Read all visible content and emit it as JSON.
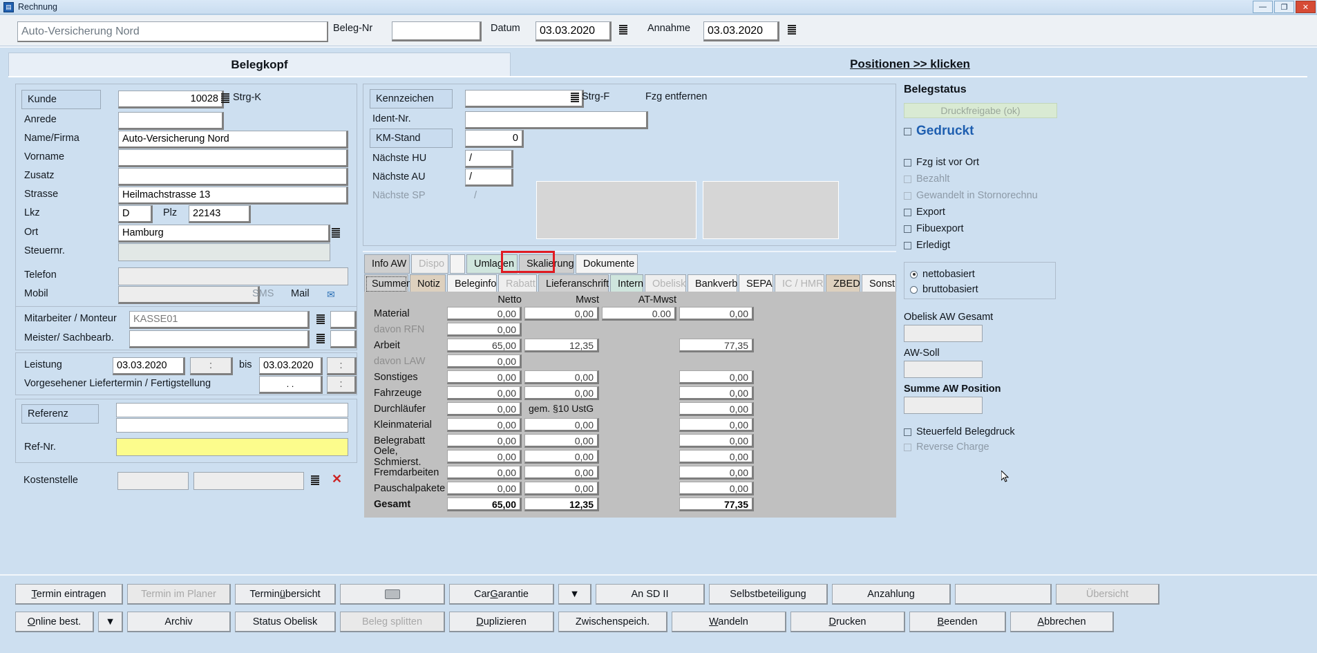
{
  "window": {
    "title": "Rechnung",
    "minimize": "—",
    "maximize": "❐",
    "close": "✕"
  },
  "toprow": {
    "customer_name": "Auto-Versicherung Nord",
    "beleg_nr_label": "Beleg-Nr",
    "beleg_nr_value": "",
    "datum_label": "Datum",
    "datum_value": "03.03.2020",
    "annahme_label": "Annahme",
    "annahme_value": "03.03.2020"
  },
  "panels": {
    "belegkopf_title": "Belegkopf",
    "positionen_title": "Positionen >> klicken"
  },
  "customer": {
    "kunde_label": "Kunde",
    "kunde_value": "10028",
    "kunde_shortcut": "Strg-K",
    "anrede_label": "Anrede",
    "anrede_value": "",
    "name_label": "Name/Firma",
    "name_value": "Auto-Versicherung Nord",
    "vorname_label": "Vorname",
    "vorname_value": "",
    "zusatz_label": "Zusatz",
    "zusatz_value": "",
    "strasse_label": "Strasse",
    "strasse_value": "Heilmachstrasse 13",
    "lkz_label": "Lkz",
    "lkz_value": "D",
    "plz_label": "Plz",
    "plz_value": "22143",
    "ort_label": "Ort",
    "ort_value": "Hamburg",
    "steuernr_label": "Steuernr.",
    "steuernr_value": "",
    "telefon_label": "Telefon",
    "telefon_value": "",
    "mobil_label": "Mobil",
    "mobil_value": "",
    "sms_label": "SMS",
    "mail_label": "Mail"
  },
  "staff": {
    "mitarbeiter_label": "Mitarbeiter / Monteur",
    "mitarbeiter_value": "KASSE01",
    "meister_label": "Meister/ Sachbearb.",
    "meister_value": ""
  },
  "service": {
    "leistung_label": "Leistung",
    "leistung_from": "03.03.2020",
    "leistung_from_time": ":",
    "bis_label": "bis",
    "leistung_to": "03.03.2020",
    "leistung_to_time": ":",
    "liefertermin_label": "Vorgesehener Liefertermin / Fertigstellung",
    "liefertermin_date": ".  .",
    "liefertermin_time": ":"
  },
  "reference": {
    "referenz_label": "Referenz",
    "referenz_line1": "",
    "referenz_line2": "",
    "refnr_label": "Ref-Nr.",
    "refnr_value": "",
    "kostenstelle_label": "Kostenstelle",
    "kostenstelle_value1": "",
    "kostenstelle_value2": "",
    "clear_icon": "✕"
  },
  "vehicle": {
    "kennzeichen_label": "Kennzeichen",
    "kennzeichen_value": "",
    "kennzeichen_shortcut": "Strg-F",
    "fzg_entfernen_label": "Fzg entfernen",
    "ident_label": "Ident-Nr.",
    "ident_value": "",
    "km_label": "KM-Stand",
    "km_value": "0",
    "hu_label": "Nächste HU",
    "hu_value": "/",
    "au_label": "Nächste AU",
    "au_value": "/",
    "sp_label": "Nächste SP",
    "sp_value": "/"
  },
  "tabs_row1": [
    {
      "label": "Info AW",
      "style": "grey",
      "state": "normal"
    },
    {
      "label": "Dispo",
      "style": "grey",
      "state": "disabled"
    },
    {
      "label": "",
      "style": "light",
      "state": "normal"
    },
    {
      "label": "Umlagen",
      "style": "mint",
      "state": "normal"
    },
    {
      "label": "Skalierung",
      "style": "grey",
      "state": "highlighted"
    },
    {
      "label": "Dokumente",
      "style": "light",
      "state": "normal"
    }
  ],
  "tabs_row2": [
    {
      "label": "Summen",
      "style": "grey",
      "state": "selected"
    },
    {
      "label": "Notiz",
      "style": "tan",
      "state": "normal"
    },
    {
      "label": "Beleginfo",
      "style": "light",
      "state": "normal"
    },
    {
      "label": "Rabatt",
      "style": "grey",
      "state": "disabled"
    },
    {
      "label": "Lieferanschrift",
      "style": "grey",
      "state": "normal"
    },
    {
      "label": "Intern",
      "style": "mint",
      "state": "normal"
    },
    {
      "label": "Obelisk",
      "style": "light",
      "state": "disabled"
    },
    {
      "label": "Bankverb",
      "style": "light",
      "state": "normal"
    },
    {
      "label": "SEPA",
      "style": "light",
      "state": "normal"
    },
    {
      "label": "IC / HMR",
      "style": "light",
      "state": "disabled"
    },
    {
      "label": "ZBED",
      "style": "tan",
      "state": "normal"
    },
    {
      "label": "Sonst",
      "style": "light",
      "state": "normal"
    }
  ],
  "summen": {
    "columns": [
      "Netto",
      "Mwst",
      "AT-Mwst",
      ""
    ],
    "rows": [
      {
        "label": "Material",
        "dim": false,
        "bold": false,
        "netto": "0,00",
        "mwst": "0,00",
        "atmwst": "0.00",
        "total": "0,00"
      },
      {
        "label": "davon RFN",
        "dim": true,
        "bold": false,
        "netto": "0,00",
        "mwst": "",
        "atmwst": "",
        "total": ""
      },
      {
        "label": "Arbeit",
        "dim": false,
        "bold": false,
        "netto": "65,00",
        "mwst": "12,35",
        "atmwst": "",
        "total": "77,35"
      },
      {
        "label": "davon LAW",
        "dim": true,
        "bold": false,
        "netto": "0,00",
        "mwst": "",
        "atmwst": "",
        "total": ""
      },
      {
        "label": "Sonstiges",
        "dim": false,
        "bold": false,
        "netto": "0,00",
        "mwst": "0,00",
        "atmwst": "",
        "total": "0,00"
      },
      {
        "label": "Fahrzeuge",
        "dim": false,
        "bold": false,
        "netto": "0,00",
        "mwst": "0,00",
        "atmwst": "",
        "total": "0,00"
      },
      {
        "label": "Durchläufer",
        "dim": false,
        "bold": false,
        "netto": "0,00",
        "mwst": "gem. §10 UstG",
        "atmwst": "",
        "total": "0,00"
      },
      {
        "label": "Kleinmaterial",
        "dim": false,
        "bold": false,
        "netto": "0,00",
        "mwst": "0,00",
        "atmwst": "",
        "total": "0,00"
      },
      {
        "label": "Belegrabatt",
        "dim": false,
        "bold": false,
        "netto": "0,00",
        "mwst": "0,00",
        "atmwst": "",
        "total": "0,00"
      },
      {
        "label": "Oele, Schmierst.",
        "dim": false,
        "bold": false,
        "netto": "0,00",
        "mwst": "0,00",
        "atmwst": "",
        "total": "0,00"
      },
      {
        "label": "Fremdarbeiten",
        "dim": false,
        "bold": false,
        "netto": "0,00",
        "mwst": "0,00",
        "atmwst": "",
        "total": "0,00"
      },
      {
        "label": "Pauschalpakete",
        "dim": false,
        "bold": false,
        "netto": "0,00",
        "mwst": "0,00",
        "atmwst": "",
        "total": "0,00"
      },
      {
        "label": "Gesamt",
        "dim": false,
        "bold": true,
        "netto": "65,00",
        "mwst": "12,35",
        "atmwst": "",
        "total": "77,35"
      }
    ]
  },
  "status": {
    "title": "Belegstatus",
    "druckfreigabe": "Druckfreigabe (ok)",
    "gedruckt": "Gedruckt",
    "checkboxes": [
      {
        "label": "Fzg ist vor Ort",
        "dim": false
      },
      {
        "label": "Bezahlt",
        "dim": true
      },
      {
        "label": "Gewandelt in Stornorechnu",
        "dim": true
      },
      {
        "label": "Export",
        "dim": false
      },
      {
        "label": "Fibuexport",
        "dim": false
      },
      {
        "label": "Erledigt",
        "dim": false
      }
    ],
    "radios": [
      {
        "label": "nettobasiert",
        "selected": true
      },
      {
        "label": "bruttobasiert",
        "selected": false
      }
    ],
    "obelisk_aw_label": "Obelisk AW Gesamt",
    "obelisk_aw_value": "",
    "aw_soll_label": "AW-Soll",
    "aw_soll_value": "",
    "summe_aw_label": "Summe AW Position",
    "summe_aw_value": "",
    "steuerfeld_label": "Steuerfeld Belegdruck",
    "reverse_charge_label": "Reverse Charge"
  },
  "buttons_row1": [
    {
      "label": "Termin eintragen",
      "accesskey": "T",
      "disabled": false
    },
    {
      "label": "Termin im Planer",
      "accesskey": "",
      "disabled": true
    },
    {
      "label": "Terminübersicht",
      "accesskey": "ü",
      "disabled": false
    },
    {
      "label": "",
      "accesskey": "",
      "disabled": false,
      "icon": "printer-icon"
    },
    {
      "label": "CarGarantie",
      "accesskey": "G",
      "disabled": false
    },
    {
      "label": "▼",
      "accesskey": "",
      "disabled": false
    },
    {
      "label": "An SD II",
      "accesskey": "",
      "disabled": false
    },
    {
      "label": "Selbstbeteiligung",
      "accesskey": "",
      "disabled": false
    },
    {
      "label": "Anzahlung",
      "accesskey": "",
      "disabled": false
    },
    {
      "label": "",
      "accesskey": "",
      "disabled": false
    },
    {
      "label": "Übersicht",
      "accesskey": "",
      "disabled": true
    }
  ],
  "buttons_row2": [
    {
      "label": "Online best.",
      "accesskey": "O",
      "disabled": false
    },
    {
      "label": "▼",
      "accesskey": "",
      "disabled": false
    },
    {
      "label": "Archiv",
      "accesskey": "",
      "disabled": false
    },
    {
      "label": "Status Obelisk",
      "accesskey": "",
      "disabled": false
    },
    {
      "label": "Beleg splitten",
      "accesskey": "",
      "disabled": true
    },
    {
      "label": "Duplizieren",
      "accesskey": "D",
      "disabled": false
    },
    {
      "label": "Zwischenspeich.",
      "accesskey": "",
      "disabled": false
    },
    {
      "label": "Wandeln",
      "accesskey": "W",
      "disabled": false
    },
    {
      "label": "Drucken",
      "accesskey": "D",
      "disabled": false
    },
    {
      "label": "Beenden",
      "accesskey": "B",
      "disabled": false
    },
    {
      "label": "Abbrechen",
      "accesskey": "A",
      "disabled": false
    }
  ],
  "colors": {
    "window_bg": "#cddff0",
    "accent_red": "#e11b22",
    "gedruckt_blue": "#1f5fb0",
    "druckfreigabe_bg": "#d9ead3",
    "refnr_yellow": "#fcfc8c",
    "table_bg": "#c0c0c0"
  }
}
